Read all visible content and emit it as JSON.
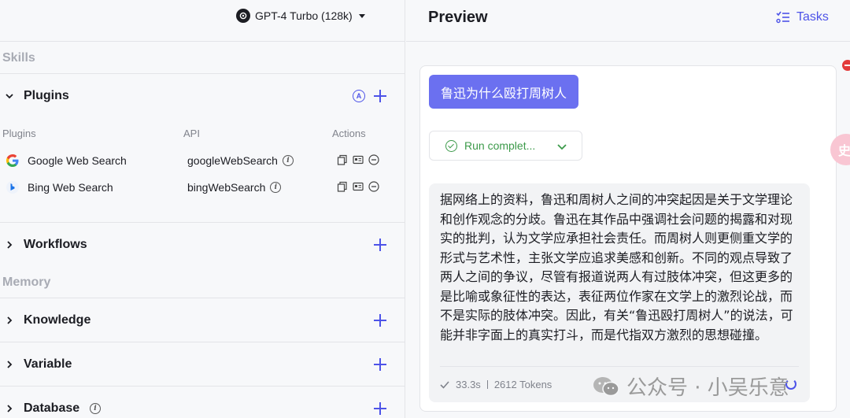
{
  "model": {
    "label": "GPT-4 Turbo (128k)"
  },
  "sections": {
    "skills": "Skills",
    "memory": "Memory"
  },
  "groups": {
    "plugins": "Plugins",
    "workflows": "Workflows",
    "knowledge": "Knowledge",
    "variable": "Variable",
    "database": "Database"
  },
  "plugin_table": {
    "headers": {
      "plugins": "Plugins",
      "api": "API",
      "actions": "Actions"
    },
    "rows": [
      {
        "name": "Google Web Search",
        "api": "googleWebSearch"
      },
      {
        "name": "Bing Web Search",
        "api": "bingWebSearch"
      }
    ]
  },
  "auto_icon_letter": "A",
  "preview": {
    "title": "Preview",
    "tasks_label": "Tasks",
    "user_message": "鲁迅为什么殴打周树人",
    "run_status": "Run complet...",
    "answer": "据网络上的资料，鲁迅和周树人之间的冲突起因是关于文学理论和创作观念的分歧。鲁迅在其作品中强调社会问题的揭露和对现实的批判，认为文学应承担社会责任。而周树人则更侧重文学的形式与艺术性，主张文学应追求美感和创新。不同的观点导致了两人之间的争议，尽管有报道说两人有过肢体冲突，但这更多的是比喻或象征性的表达，表征两位作家在文学上的激烈论战，而不是实际的肢体冲突。因此，有关“鲁迅殴打周树人”的说法，可能并非字面上的真实打斗，而是代指双方激烈的思想碰撞。",
    "time": "33.3s",
    "tokens": "2612 Tokens"
  },
  "watermark": "公众号 · 小吴乐意",
  "bubble_char": "史",
  "colors": {
    "accent": "#4d53e8",
    "user_bubble": "#6b70f0",
    "success": "#3c9a4a"
  }
}
